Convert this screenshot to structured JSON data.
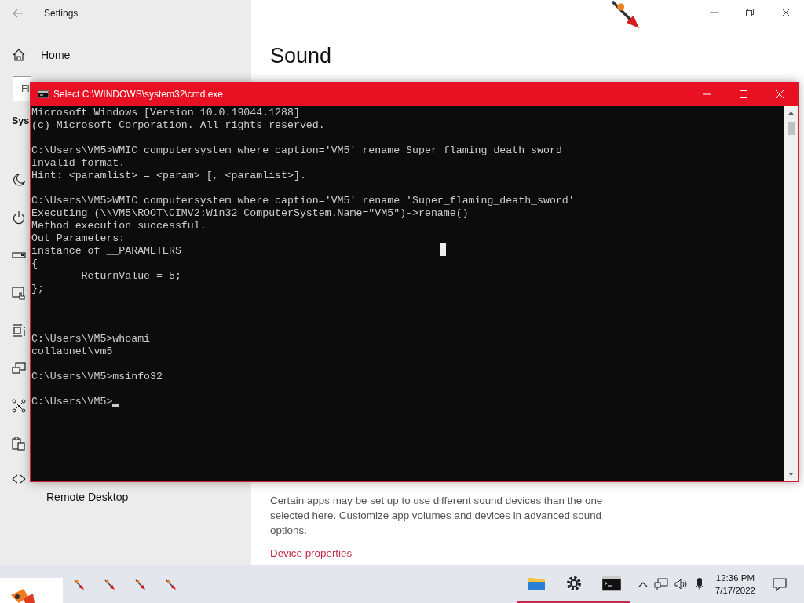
{
  "settings": {
    "title": "Settings",
    "home": "Home",
    "search": {
      "placeholder": "Fi"
    },
    "section": "Sys",
    "nav_items": [
      {
        "kind": "moon"
      },
      {
        "kind": "power"
      },
      {
        "kind": "battery"
      },
      {
        "kind": "tablet"
      },
      {
        "kind": "multitask"
      },
      {
        "kind": "project"
      },
      {
        "kind": "share"
      },
      {
        "kind": "clipboard"
      },
      {
        "kind": "remote",
        "label": "Remote Desktop"
      }
    ],
    "page_title": "Sound",
    "description": "Certain apps may be set up to use different sound devices than the one selected here. Customize app volumes and devices in advanced sound options.",
    "link": "Device properties"
  },
  "console": {
    "title": "Select C:\\WINDOWS\\system32\\cmd.exe",
    "cursor_visible": true,
    "blocks": [
      {
        "extra_gap": false,
        "lines": [
          "Microsoft Windows [Version 10.0.19044.1288]",
          "(c) Microsoft Corporation. All rights reserved."
        ]
      },
      {
        "extra_gap": false,
        "lines": [
          "C:\\Users\\VM5>WMIC computersystem where caption='VM5' rename Super flaming death sword",
          "Invalid format.",
          "Hint: <paramlist> = <param> [, <paramlist>]."
        ]
      },
      {
        "extra_gap": false,
        "lines": [
          "C:\\Users\\VM5>WMIC computersystem where caption='VM5' rename 'Super_flaming_death_sword'",
          "Executing (\\\\VM5\\ROOT\\CIMV2:Win32_ComputerSystem.Name=\"VM5\")->rename()",
          "Method execution successful.",
          "Out Parameters:",
          "instance of __PARAMETERS",
          "{",
          "        ReturnValue = 5;",
          "};"
        ]
      },
      {
        "extra_gap": true,
        "lines": [
          "C:\\Users\\VM5>whoami",
          "collabnet\\vm5"
        ]
      },
      {
        "extra_gap": false,
        "lines": [
          "C:\\Users\\VM5>msinfo32"
        ]
      },
      {
        "extra_gap": false,
        "lines": [
          "C:\\Users\\VM5>"
        ]
      }
    ]
  },
  "taskbar": {
    "apps": [
      {
        "kind": "folder",
        "open": true
      },
      {
        "kind": "gear",
        "open": true
      },
      {
        "kind": "terminal",
        "open": true
      }
    ],
    "time": "12:36 PM",
    "date": "7/17/2022"
  }
}
